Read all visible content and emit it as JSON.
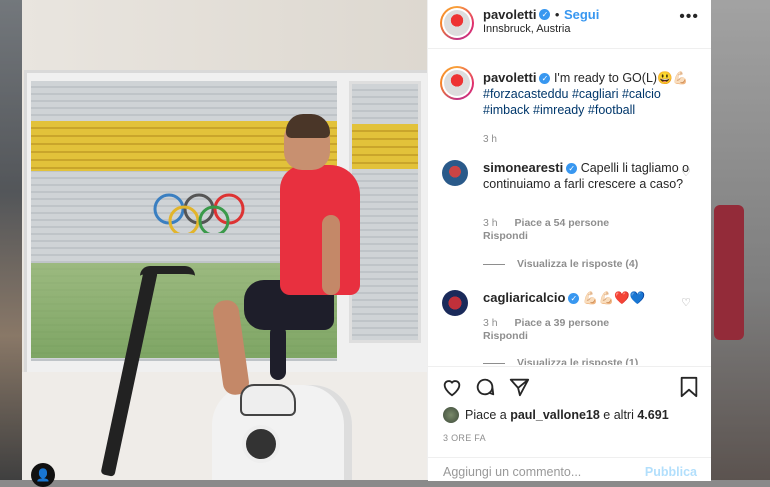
{
  "post": {
    "username": "pavoletti",
    "follow_label": "Segui",
    "location": "Innsbruck, Austria",
    "more": "•••"
  },
  "caption": {
    "username": "pavoletti",
    "text": "I'm ready to GO(L)😃💪🏻",
    "hashtags_line1": "#forzacasteddu #cagliari #calcio",
    "hashtags_line2": "#imback #imready #football",
    "time": "3 h"
  },
  "comments": [
    {
      "username": "simonearesti",
      "text": "Capelli li tagliamo o continuiamo a farli crescere a caso?",
      "time": "3 h",
      "likes": "Piace a 54 persone",
      "reply": "Rispondi",
      "view_replies": "Visualizza le risposte (4)"
    },
    {
      "username": "cagliaricalcio",
      "text": "💪🏻💪🏻❤️💙",
      "time": "3 h",
      "likes": "Piace a 39 persone",
      "reply": "Rispondi",
      "view_replies": "Visualizza le risposte (1)"
    }
  ],
  "actions": {
    "liked_by_prefix": "Piace a",
    "liked_by_user": "paul_vallone18",
    "liked_by_mid": "e altri",
    "liked_by_count": "4.691",
    "ago": "3 ORE FA"
  },
  "add_comment": {
    "placeholder": "Aggiungi un commento...",
    "publish": "Pubblica"
  }
}
